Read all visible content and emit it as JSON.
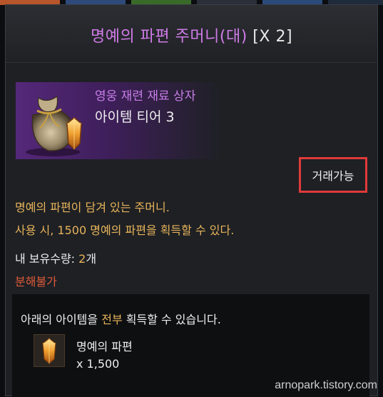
{
  "title": {
    "name": "명예의 파편 주머니(대)",
    "count": "[X 2]"
  },
  "item": {
    "subtitle": "영웅 재련 재료 상자",
    "tier": "아이템 티어 3",
    "icon": "pouch-with-crystal-icon"
  },
  "trade_label": "거래가능",
  "description": [
    "명예의 파편이 담겨 있는 주머니.",
    "사용 시, 1500 명예의 파편을 획득할 수 있다."
  ],
  "holdings": {
    "label": "내 보유수량: ",
    "value": "2",
    "unit": "개"
  },
  "disassemble": "분해불가",
  "reward": {
    "prefix": "아래의 아이템을 ",
    "highlight": "전부",
    "suffix": " 획득할 수 있습니다.",
    "item_name": "명예의 파편",
    "item_qty": "x 1,500",
    "icon": "honor-shard-crystal-icon"
  },
  "watermark": "arnopark.tistory.com",
  "colors": {
    "title_purple": "#d07be8",
    "gold_text": "#e8b45a",
    "red_text": "#e05a3a",
    "highlight_border": "#e03a3a"
  }
}
